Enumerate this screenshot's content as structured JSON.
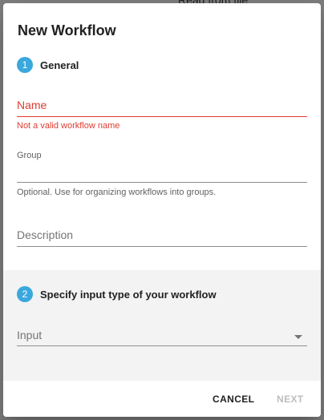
{
  "backdrop": {
    "partial_text": "Read from file"
  },
  "dialog": {
    "title": "New Workflow",
    "steps": [
      {
        "number": "1",
        "title": "General",
        "fields": {
          "name": {
            "label": "Name",
            "value": "",
            "error": "Not a valid workflow name"
          },
          "group": {
            "label": "Group",
            "value": "",
            "hint": "Optional. Use for organizing workflows into groups."
          },
          "description": {
            "label": "Description",
            "value": ""
          }
        }
      },
      {
        "number": "2",
        "title": "Specify input type of your workflow",
        "fields": {
          "input": {
            "label": "Input",
            "value": ""
          }
        }
      }
    ],
    "actions": {
      "cancel": "CANCEL",
      "next": "NEXT"
    }
  },
  "colors": {
    "accent": "#3aa8dc",
    "error": "#dd3c33",
    "section_bg": "#f3f3f3",
    "disabled": "#bdbdbd"
  }
}
